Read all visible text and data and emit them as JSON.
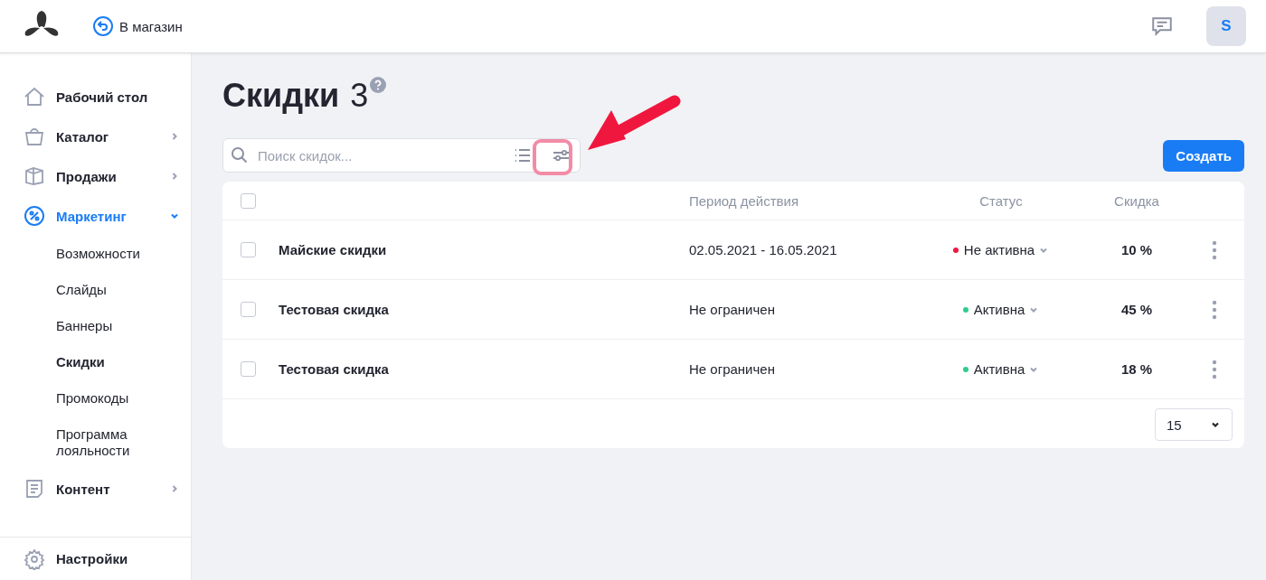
{
  "header": {
    "back_link": "В магазин",
    "avatar": "S"
  },
  "sidebar": {
    "items": [
      {
        "label": "Рабочий стол",
        "selected": false
      },
      {
        "label": "Каталог",
        "expanded": false,
        "selected": false
      },
      {
        "label": "Продажи",
        "expanded": false,
        "selected": false
      },
      {
        "label": "Маркетинг",
        "expanded": true,
        "selected": true,
        "children": [
          {
            "label": "Возможности",
            "selected": false
          },
          {
            "label": "Слайды",
            "selected": false
          },
          {
            "label": "Баннеры",
            "selected": false
          },
          {
            "label": "Скидки",
            "selected": true
          },
          {
            "label": "Промокоды",
            "selected": false
          },
          {
            "label": "Программа лояльности",
            "selected": false
          }
        ]
      },
      {
        "label": "Контент",
        "expanded": false,
        "selected": false
      }
    ],
    "footer_item": "Настройки"
  },
  "page": {
    "title": "Скидки",
    "count": "3"
  },
  "search": {
    "placeholder": "Поиск скидок..."
  },
  "create_button": "Создать",
  "table": {
    "select_all_checked": false,
    "columns": [
      "Период действия",
      "Статус",
      "Скидка"
    ],
    "rows": [
      {
        "name": "Майские скидки",
        "period": "02.05.2021 - 16.05.2021",
        "status": "Не активна",
        "color": "#f0173f",
        "discount": "10 %",
        "checked": false
      },
      {
        "name": "Тестовая скидка",
        "period": "Не ограничен",
        "status": "Активна",
        "color": "#2ecc8f",
        "discount": "45 %",
        "checked": false
      },
      {
        "name": "Тестовая скидка",
        "period": "Не ограничен",
        "status": "Активна",
        "color": "#2ecc8f",
        "discount": "18 %",
        "checked": false
      }
    ],
    "page_size": "15"
  }
}
